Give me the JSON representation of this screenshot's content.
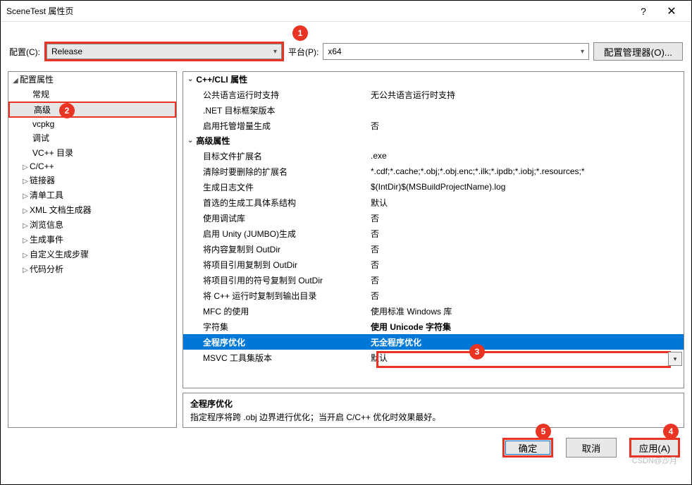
{
  "window": {
    "title": "SceneTest 属性页"
  },
  "toprow": {
    "config_label": "配置(C):",
    "config_value": "Release",
    "platform_label": "平台(P):",
    "platform_value": "x64",
    "config_mgr": "配置管理器(O)..."
  },
  "tree": {
    "root": "配置属性",
    "items": [
      {
        "label": "常规"
      },
      {
        "label": "高级",
        "selected": true
      },
      {
        "label": "vcpkg"
      },
      {
        "label": "调试"
      },
      {
        "label": "VC++ 目录"
      },
      {
        "label": "C/C++",
        "expandable": true
      },
      {
        "label": "链接器",
        "expandable": true
      },
      {
        "label": "清单工具",
        "expandable": true
      },
      {
        "label": "XML 文档生成器",
        "expandable": true
      },
      {
        "label": "浏览信息",
        "expandable": true
      },
      {
        "label": "生成事件",
        "expandable": true
      },
      {
        "label": "自定义生成步骤",
        "expandable": true
      },
      {
        "label": "代码分析",
        "expandable": true
      }
    ]
  },
  "groups": [
    {
      "name": "C++/CLI 属性",
      "rows": [
        {
          "name": "公共语言运行时支持",
          "value": "无公共语言运行时支持"
        },
        {
          "name": ".NET 目标框架版本",
          "value": ""
        },
        {
          "name": "启用托管增量生成",
          "value": "否"
        }
      ]
    },
    {
      "name": "高级属性",
      "rows": [
        {
          "name": "目标文件扩展名",
          "value": ".exe"
        },
        {
          "name": "清除时要删除的扩展名",
          "value": "*.cdf;*.cache;*.obj;*.obj.enc;*.ilk;*.ipdb;*.iobj;*.resources;*"
        },
        {
          "name": "生成日志文件",
          "value": "$(IntDir)$(MSBuildProjectName).log"
        },
        {
          "name": "首选的生成工具体系结构",
          "value": "默认"
        },
        {
          "name": "使用调试库",
          "value": "否"
        },
        {
          "name": "启用 Unity (JUMBO)生成",
          "value": "否"
        },
        {
          "name": "将内容复制到 OutDir",
          "value": "否"
        },
        {
          "name": "将项目引用复制到 OutDir",
          "value": "否"
        },
        {
          "name": "将项目引用的符号复制到 OutDir",
          "value": "否"
        },
        {
          "name": "将 C++ 运行时复制到输出目录",
          "value": "否"
        },
        {
          "name": "MFC 的使用",
          "value": "使用标准 Windows 库"
        },
        {
          "name": "字符集",
          "value": "使用 Unicode 字符集",
          "bold": true
        },
        {
          "name": "全程序优化",
          "value": "无全程序优化",
          "selected": true
        },
        {
          "name": "MSVC 工具集版本",
          "value": "默认"
        }
      ]
    }
  ],
  "desc": {
    "title": "全程序优化",
    "text": "指定程序将跨 .obj 边界进行优化；当开启 C/C++ 优化时效果最好。"
  },
  "footer": {
    "ok": "确定",
    "cancel": "取消",
    "apply": "应用(A)"
  },
  "badges": {
    "b1": "1",
    "b2": "2",
    "b3": "3",
    "b4": "4",
    "b5": "5"
  },
  "watermark": "CSDN@沙月"
}
